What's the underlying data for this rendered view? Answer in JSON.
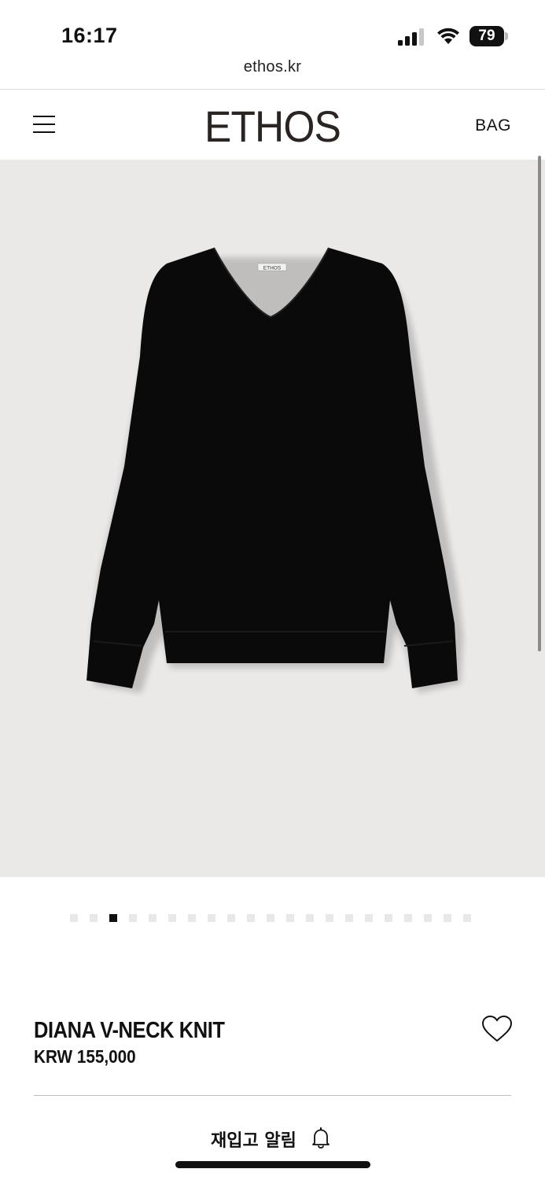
{
  "status_bar": {
    "time": "16:17",
    "battery_level": "79",
    "icons": [
      "signal-icon",
      "wifi-icon",
      "battery-icon"
    ]
  },
  "browser": {
    "url": "ethos.kr"
  },
  "header": {
    "menu_icon": "hamburger-menu-icon",
    "logo": "ETHOS",
    "bag_label": "BAG"
  },
  "product": {
    "name": "DIANA V-NECK KNIT",
    "price": "KRW 155,000",
    "image_tag_text": "ETHOS",
    "image_background": "#ebe9e8",
    "garment_color": "#0a0a0a"
  },
  "carousel": {
    "total": 21,
    "active_index": 2
  },
  "actions": {
    "restock_label": "재입고 알림",
    "wishlist_icon": "heart-icon",
    "restock_icon": "bell-icon"
  }
}
